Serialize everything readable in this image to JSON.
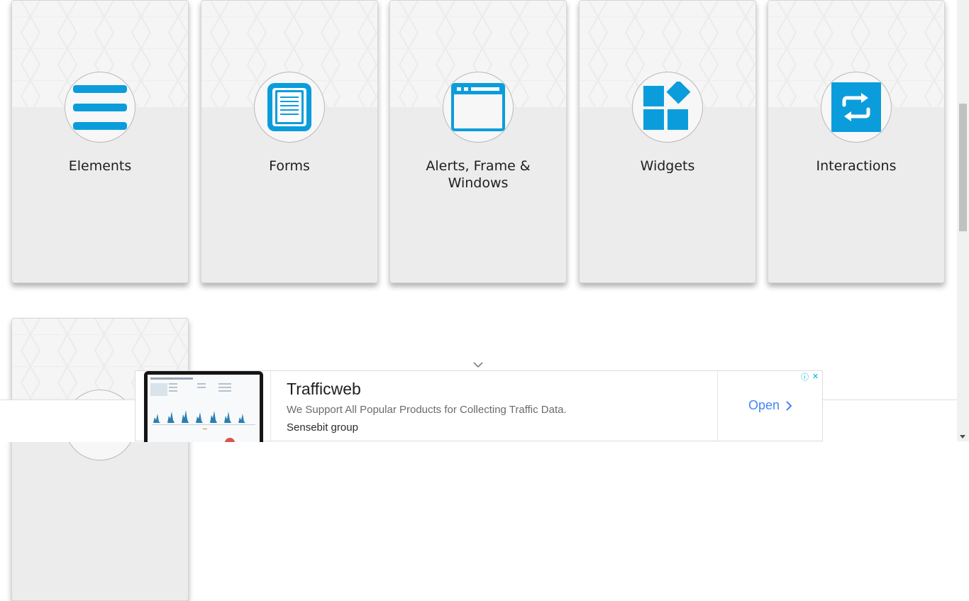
{
  "cards": [
    {
      "title": "Elements",
      "icon": "hamburger-icon"
    },
    {
      "title": "Forms",
      "icon": "document-icon"
    },
    {
      "title": "Alerts, Frame & Windows",
      "icon": "browser-window-icon"
    },
    {
      "title": "Widgets",
      "icon": "widgets-icon"
    },
    {
      "title": "Interactions",
      "icon": "swap-arrows-icon"
    },
    {
      "title": "",
      "icon": ""
    }
  ],
  "colors": {
    "accent": "#0b9ddb",
    "card_background": "#ececec",
    "cta": "#4285f4"
  },
  "ad": {
    "headline": "Trafficweb",
    "description": "We Support All Popular Products for Collecting Traffic Data.",
    "advertiser": "Sensebit group",
    "cta_label": "Open",
    "info_symbol": "ⓘ",
    "close_symbol": "✕"
  }
}
